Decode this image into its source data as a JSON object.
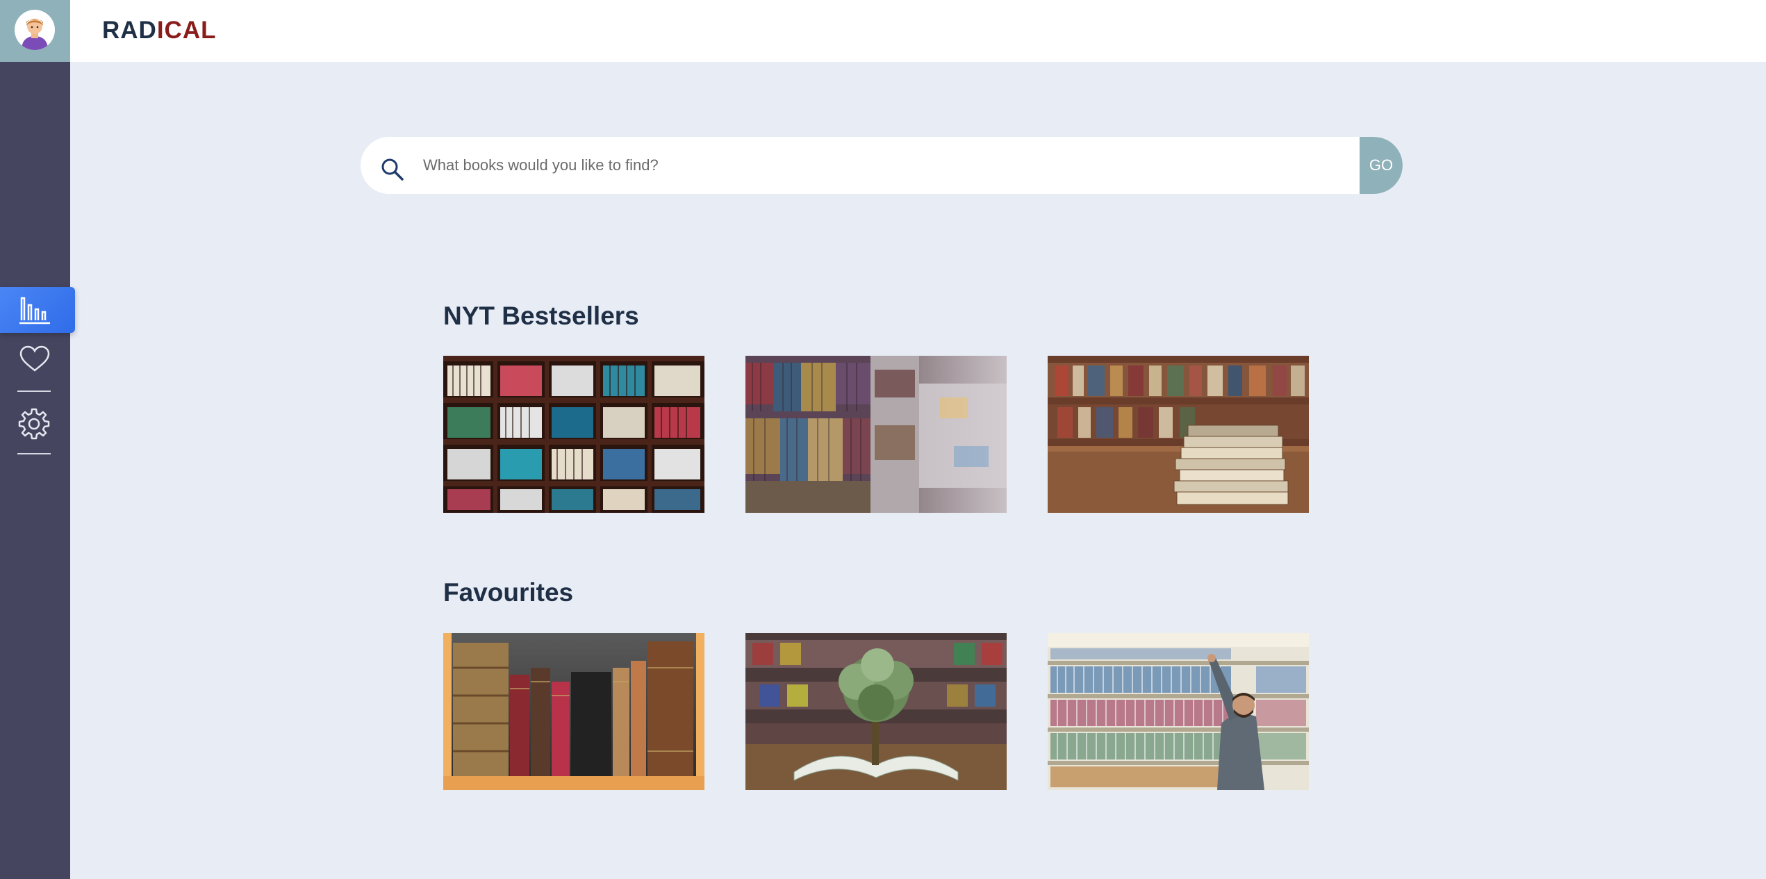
{
  "header": {
    "logo_part1": "RAD",
    "logo_part2": "ICAL"
  },
  "sidebar": {
    "items": [
      {
        "name": "analytics",
        "icon": "bar-chart-icon",
        "active": true
      },
      {
        "name": "favourites",
        "icon": "heart-icon",
        "active": false
      },
      {
        "name": "settings",
        "icon": "gear-icon",
        "active": false
      }
    ]
  },
  "search": {
    "placeholder": "What books would you like to find?",
    "go_label": "GO"
  },
  "sections": [
    {
      "title": "NYT Bestsellers",
      "books": [
        "bookshelf-grid",
        "library-aisle",
        "book-stack-on-table"
      ]
    },
    {
      "title": "Favourites",
      "books": [
        "antique-books",
        "money-tree-book",
        "man-reaching-shelf"
      ]
    }
  ],
  "colors": {
    "sidebar": "#454560",
    "accent": "#8fb1b9",
    "active": "#3a78f0",
    "background": "#e8ecf5",
    "logo_red": "#8a1c1c",
    "logo_dark": "#1f3046"
  }
}
